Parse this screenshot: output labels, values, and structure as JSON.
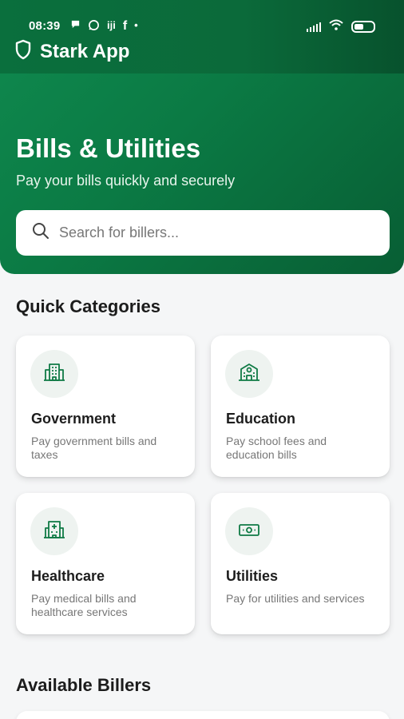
{
  "status_bar": {
    "time": "08:39",
    "notification_icons": [
      "message-bubble-icon",
      "whatsapp-icon",
      "app-icon",
      "facebook-icon",
      "dot-icon"
    ],
    "app_glyph": "iji",
    "facebook_glyph": "f",
    "dot": "•"
  },
  "app_bar": {
    "title": "Stark App"
  },
  "header": {
    "title": "Bills & Utilities",
    "subtitle": "Pay your bills quickly and securely"
  },
  "search": {
    "placeholder": "Search for billers..."
  },
  "quick_categories": {
    "title": "Quick Categories",
    "items": [
      {
        "title": "Government",
        "description": "Pay government bills and taxes",
        "icon": "building-icon"
      },
      {
        "title": "Education",
        "description": "Pay school fees and education bills",
        "icon": "school-icon"
      },
      {
        "title": "Healthcare",
        "description": "Pay medical bills and healthcare services",
        "icon": "hospital-icon"
      },
      {
        "title": "Utilities",
        "description": "Pay for utilities and services",
        "icon": "cash-icon"
      }
    ]
  },
  "available_billers": {
    "title": "Available Billers"
  },
  "colors": {
    "primary": "#0b7a44",
    "icon": "#0f7a45",
    "icon_bg": "#eef3f0"
  }
}
